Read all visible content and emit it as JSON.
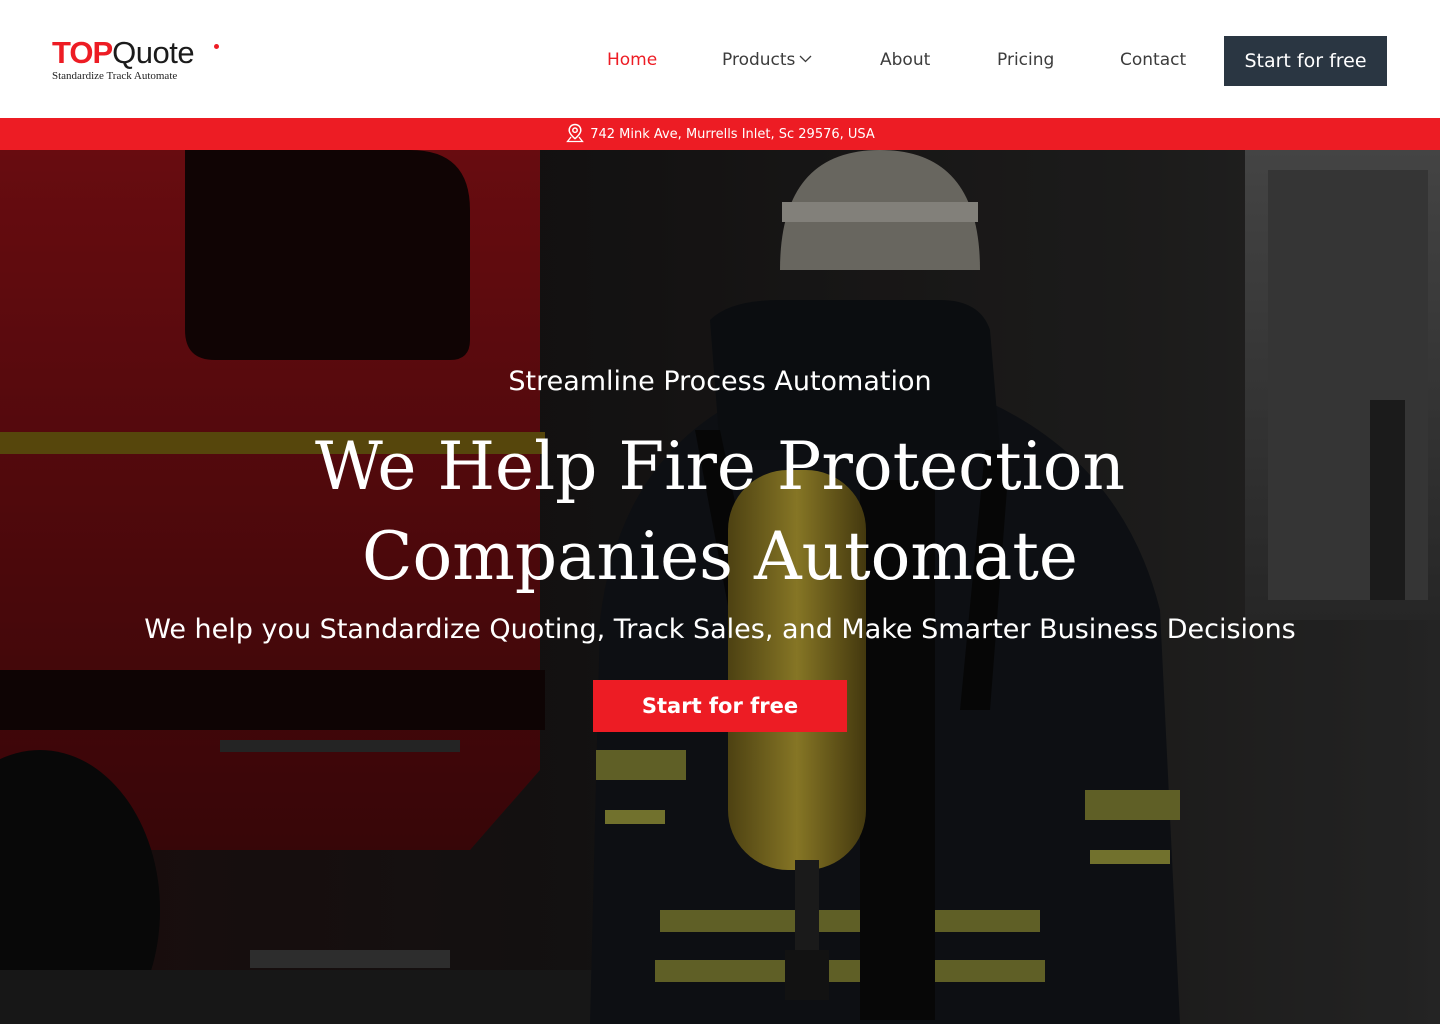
{
  "colors": {
    "brand_red": "#ed1c24",
    "dark_navy": "#2a3642",
    "nav_text": "#3c3c3c",
    "white": "#ffffff"
  },
  "logo": {
    "top": "TOP",
    "quote": "Quote",
    "tagline": "Standardize Track Automate"
  },
  "nav": {
    "items": [
      {
        "label": "Home",
        "active": true
      },
      {
        "label": "Products",
        "has_dropdown": true,
        "icon": "chevron-down-icon"
      },
      {
        "label": "About"
      },
      {
        "label": "Pricing"
      },
      {
        "label": "Contact"
      }
    ],
    "cta": "Start for free"
  },
  "address_bar": {
    "icon": "map-pin-icon",
    "text": "742 Mink Ave, Murrells Inlet, Sc 29576, USA"
  },
  "hero": {
    "background": "firefighter-with-air-tank-beside-red-fire-truck",
    "eyebrow": "Streamline Process Automation",
    "title": "We Help Fire Protection Companies Automate",
    "subtitle": "We help you Standardize Quoting, Track Sales, and Make Smarter Business Decisions",
    "cta": "Start for free"
  }
}
